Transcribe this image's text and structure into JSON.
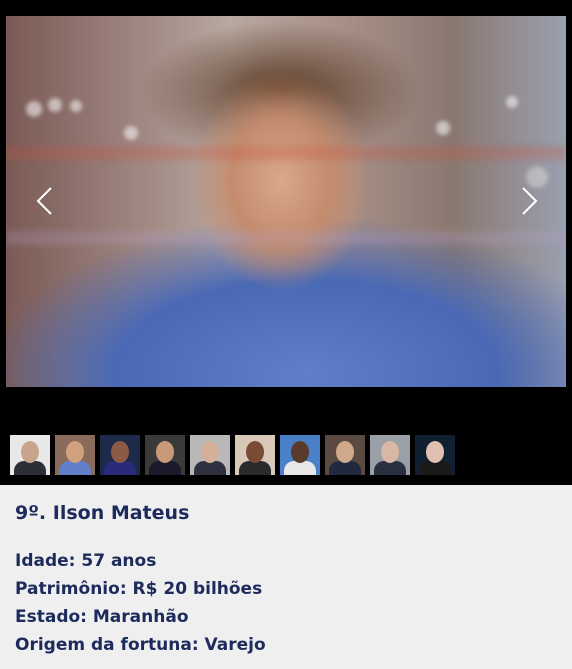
{
  "gallery": {
    "prev_icon": "chevron-left-icon",
    "next_icon": "chevron-right-icon",
    "thumbnails": [
      {
        "bg": "#e8e8e8",
        "face": "#c9a48c",
        "body": "#2d2f38"
      },
      {
        "bg": "#8a6a5a",
        "face": "#d0a07f",
        "body": "#5f7fc8"
      },
      {
        "bg": "#1e2a4a",
        "face": "#8a5a44",
        "body": "#2a2a7a"
      },
      {
        "bg": "#3a3a3a",
        "face": "#c89a7a",
        "body": "#1a1a2a"
      },
      {
        "bg": "#b8b8b8",
        "face": "#d4b09a",
        "body": "#2f3140"
      },
      {
        "bg": "#d8c8b8",
        "face": "#7a4a34",
        "body": "#2a2a2a"
      },
      {
        "bg": "#4a80c8",
        "face": "#5a3a2a",
        "body": "#e8e8e8"
      },
      {
        "bg": "#5a4a40",
        "face": "#d0a88c",
        "body": "#1f2a40"
      },
      {
        "bg": "#9aa0a8",
        "face": "#d8b8a4",
        "body": "#2a3040"
      },
      {
        "bg": "#102030",
        "face": "#e0c0b0",
        "body": "#1a1a1a"
      }
    ]
  },
  "person": {
    "title": "9º. Ilson Mateus",
    "facts": [
      "Idade: 57 anos",
      "Patrimônio: R$ 20 bilhões",
      "Estado: Maranhão",
      "Origem da fortuna: Varejo"
    ]
  }
}
